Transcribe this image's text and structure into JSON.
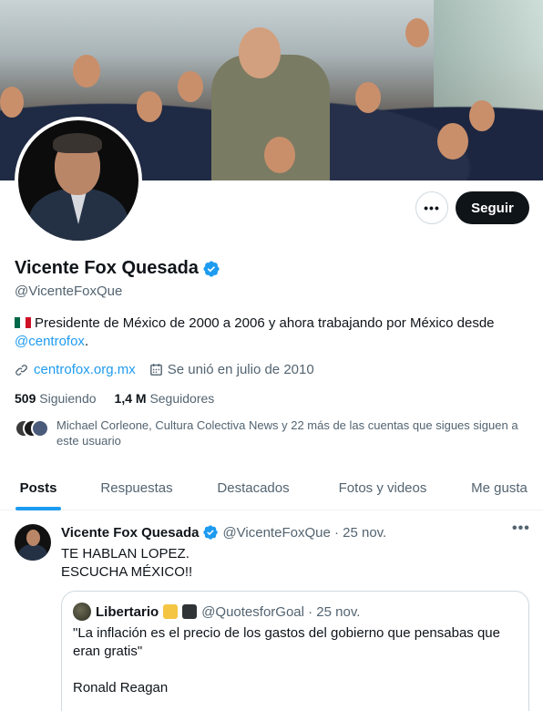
{
  "profile": {
    "display_name": "Vicente Fox Quesada",
    "handle": "@VicenteFoxQue",
    "bio_text": "Presidente de México de 2000 a 2006 y ahora trabajando por México desde ",
    "bio_link": "@centrofox",
    "bio_end": ".",
    "website": "centrofox.org.mx",
    "joined": "Se unió en julio de 2010",
    "following_count": "509",
    "following_label": "Siguiendo",
    "followers_count": "1,4 M",
    "followers_label": "Seguidores",
    "followers_you_know": "Michael Corleone, Cultura Colectiva News y 22 más de las cuentas que sigues siguen a este usuario"
  },
  "actions": {
    "more_label": "•••",
    "follow_label": "Seguir"
  },
  "tabs": [
    {
      "label": "Posts",
      "active": true
    },
    {
      "label": "Respuestas",
      "active": false
    },
    {
      "label": "Destacados",
      "active": false
    },
    {
      "label": "Fotos y videos",
      "active": false
    },
    {
      "label": "Me gusta",
      "active": false
    }
  ],
  "tweet": {
    "author": "Vicente Fox Quesada",
    "handle_time": "@VicenteFoxQue · 25 nov.",
    "more": "•••",
    "text": "TE HABLAN LOPEZ.\nESCUCHA MÉXICO!!",
    "quote": {
      "author": "Libertario",
      "handle_time": "@QuotesforGoal · 25 nov.",
      "text": "\"La inflación es el precio de los gastos del gobierno que pensabas que eran gratis\"\n\nRonald Reagan"
    }
  },
  "colors": {
    "accent": "#1d9bf0",
    "text_primary": "#0f1419",
    "text_secondary": "#536471",
    "follow_bg": "#0f1419"
  }
}
